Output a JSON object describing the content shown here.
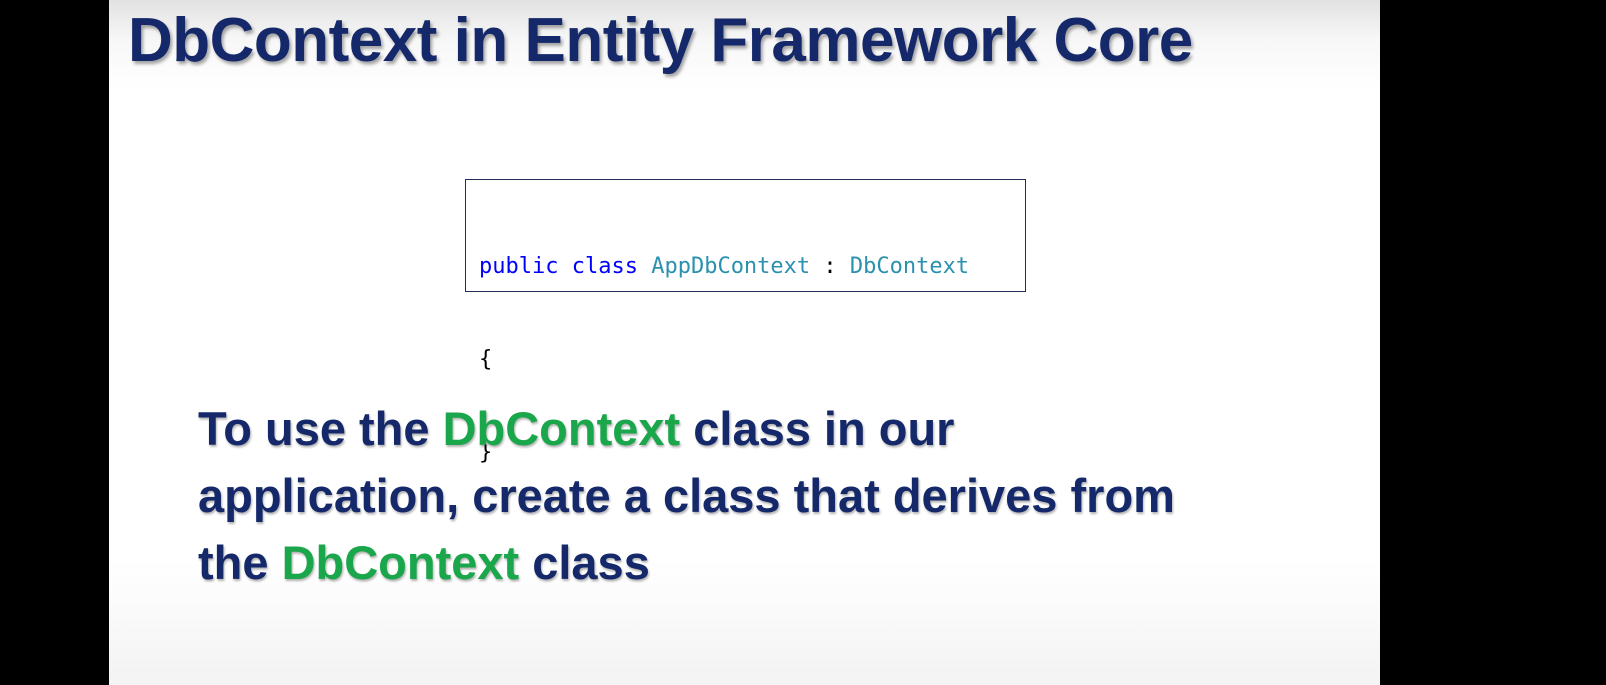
{
  "slide": {
    "title": "DbContext in Entity Framework Core",
    "code": {
      "line1": {
        "kw_public": "public",
        "kw_class": "class",
        "class_name": "AppDbContext",
        "colon": ":",
        "base_class": "DbContext"
      },
      "line2": "{",
      "line3": "}"
    },
    "body": {
      "line1_before": "To use the ",
      "line1_highlight": "DbContext",
      "line1_after": " class in our",
      "line2": "application, create a class that derives from",
      "line3_before": "the ",
      "line3_highlight": "DbContext",
      "line3_after": " class"
    }
  },
  "colors": {
    "title": "#14286a",
    "highlight": "#1aa64a",
    "code_keyword": "#0000ff",
    "code_type": "#2b91af",
    "letterbox": "#000000"
  }
}
